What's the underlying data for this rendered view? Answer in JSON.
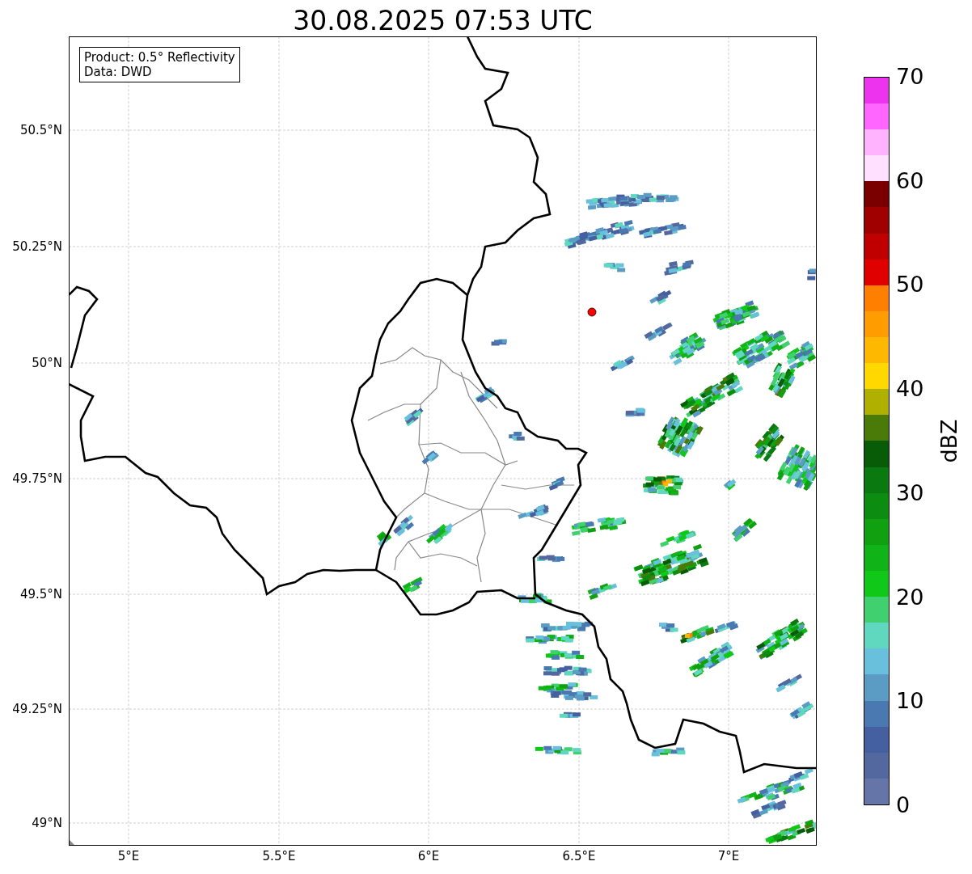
{
  "title": "30.08.2025 07:53 UTC",
  "legend_box": [
    "Product: 0.5° Reflectivity",
    "Data: DWD"
  ],
  "map": {
    "lat_ticks": [
      "50.5°N",
      "50.25°N",
      "50°N",
      "49.75°N",
      "49.5°N",
      "49.25°N",
      "49°N"
    ],
    "lon_ticks": [
      "5°E",
      "5.5°E",
      "6°E",
      "6.5°E",
      "7°E"
    ]
  },
  "colorbar": {
    "label": "dBZ",
    "ticks": [
      "70",
      "60",
      "50",
      "40",
      "30",
      "20",
      "10",
      "0"
    ],
    "bins": [
      {
        "color": "#6575a8"
      },
      {
        "color": "#5468a0"
      },
      {
        "color": "#4460a0"
      },
      {
        "color": "#4a78b0"
      },
      {
        "color": "#5a9cc4"
      },
      {
        "color": "#68c0dc"
      },
      {
        "color": "#60d8c0"
      },
      {
        "color": "#40d070"
      },
      {
        "color": "#10c818"
      },
      {
        "color": "#10b418"
      },
      {
        "color": "#10a010"
      },
      {
        "color": "#0c8c10"
      },
      {
        "color": "#0a7a10"
      },
      {
        "color": "#085c08"
      },
      {
        "color": "#4a7a08"
      },
      {
        "color": "#b0b000"
      },
      {
        "color": "#ffd800"
      },
      {
        "color": "#ffb800"
      },
      {
        "color": "#ff9c00"
      },
      {
        "color": "#ff8000"
      },
      {
        "color": "#e00000"
      },
      {
        "color": "#c00000"
      },
      {
        "color": "#a00000"
      },
      {
        "color": "#7a0000"
      },
      {
        "color": "#ffe0ff"
      },
      {
        "color": "#ffb3ff"
      },
      {
        "color": "#ff66ff"
      },
      {
        "color": "#ee33ee"
      }
    ]
  }
}
